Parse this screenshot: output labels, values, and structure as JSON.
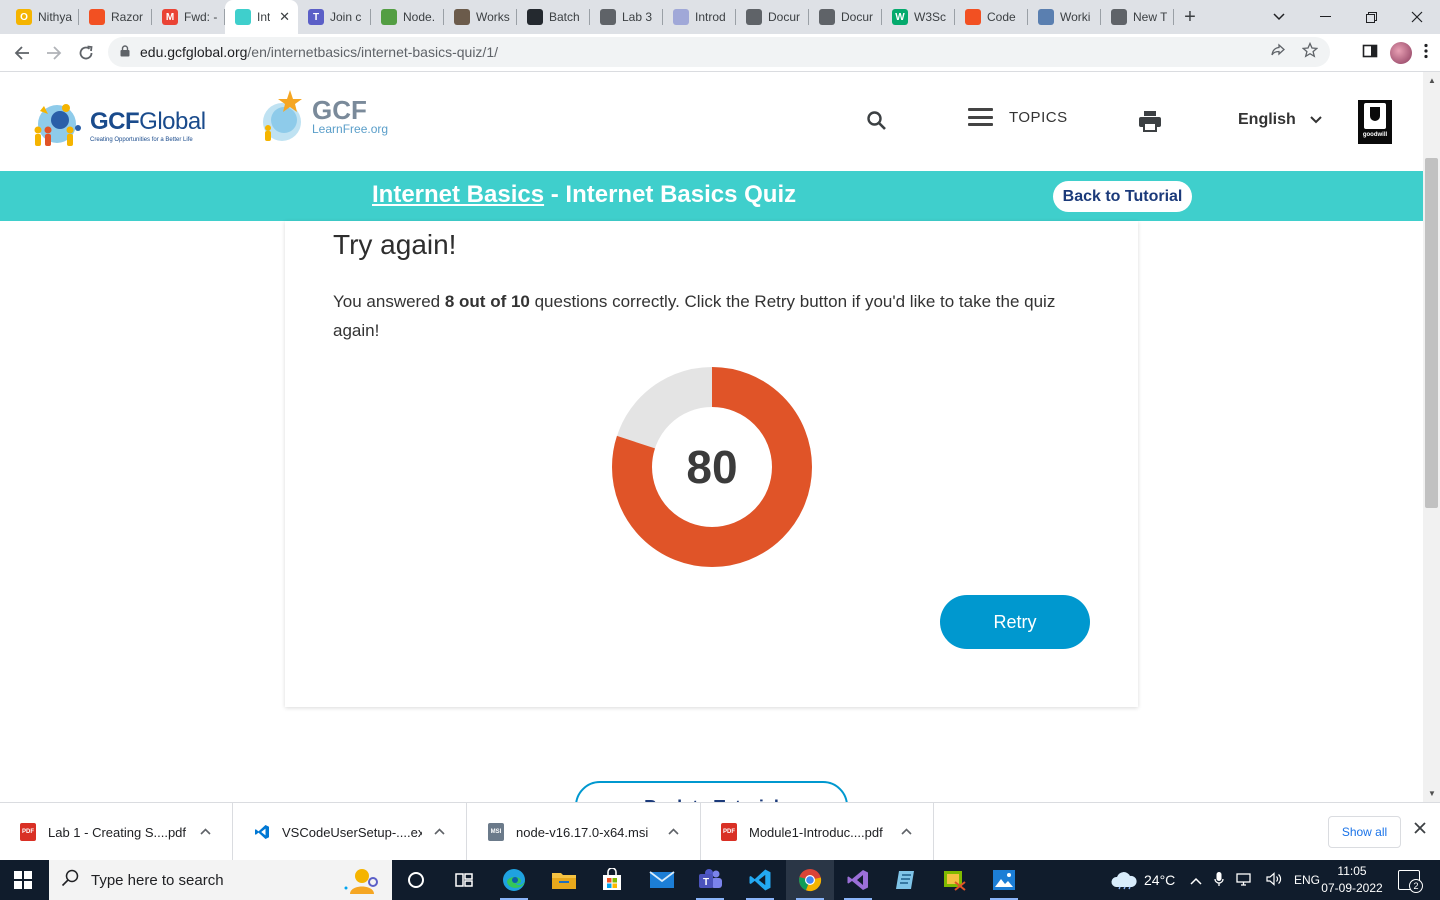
{
  "browser": {
    "tabs": [
      {
        "title": "Nithya",
        "color": "#f5b400",
        "glyph": "O"
      },
      {
        "title": "Razor",
        "color": "#f25022",
        "glyph": ""
      },
      {
        "title": "Fwd: -",
        "color": "#ea4335",
        "glyph": "M"
      },
      {
        "title": "Int",
        "color": "#3fcfcc",
        "glyph": "",
        "active": true
      },
      {
        "title": "Join c",
        "color": "#5b5fc7",
        "glyph": "T"
      },
      {
        "title": "Node.",
        "color": "#539e43",
        "glyph": ""
      },
      {
        "title": "Works",
        "color": "#6b5b4b",
        "glyph": ""
      },
      {
        "title": "Batch",
        "color": "#24292f",
        "glyph": ""
      },
      {
        "title": "Lab 3",
        "color": "#5f6368",
        "glyph": ""
      },
      {
        "title": "Introd",
        "color": "#a0a8d8",
        "glyph": ""
      },
      {
        "title": "Docur",
        "color": "#5f6368",
        "glyph": ""
      },
      {
        "title": "Docur",
        "color": "#5f6368",
        "glyph": ""
      },
      {
        "title": "W3Sc",
        "color": "#04aa6d",
        "glyph": "W"
      },
      {
        "title": "Code",
        "color": "#f25022",
        "glyph": ""
      },
      {
        "title": "Worki",
        "color": "#5a7fb0",
        "glyph": ""
      },
      {
        "title": "New T",
        "color": "#5f6368",
        "glyph": ""
      }
    ],
    "url_host": "edu.gcfglobal.org",
    "url_path": "/en/internetbasics/internet-basics-quiz/1/"
  },
  "header": {
    "logo1_main_bold": "GCF",
    "logo1_main_light": "Global",
    "logo1_tagline": "Creating Opportunities for a Better Life",
    "logo2_main": "GCF",
    "logo2_sub": "LearnFree.org",
    "topics_label": "TOPICS",
    "language": "English",
    "goodwill_text": "goodwill"
  },
  "banner": {
    "course_link": "Internet Basics",
    "separator": " - ",
    "quiz_title": "Internet Basics Quiz",
    "back_button": "Back to Tutorial"
  },
  "result": {
    "heading": "Try again!",
    "text_prefix": "You answered ",
    "score_phrase": "8 out of 10",
    "text_suffix": " questions correctly. Click the Retry button if you'd like to take the quiz again!",
    "score": "80",
    "score_percent": 80,
    "colors": {
      "correct": "#e05428",
      "remaining": "#e4e4e4"
    },
    "retry_button": "Retry",
    "bottom_back_button": "Back to Tutorial"
  },
  "downloads": {
    "items": [
      {
        "name": "Lab 1 - Creating S....pdf",
        "type": "pdf"
      },
      {
        "name": "VSCodeUserSetup-....exe",
        "type": "vscode"
      },
      {
        "name": "node-v16.17.0-x64.msi",
        "type": "msi"
      },
      {
        "name": "Module1-Introduc....pdf",
        "type": "pdf"
      }
    ],
    "show_all": "Show all"
  },
  "taskbar": {
    "search_placeholder": "Type here to search",
    "weather": "24°C",
    "language": "ENG",
    "time": "11:05",
    "date": "07-09-2022",
    "notifications": "2"
  }
}
